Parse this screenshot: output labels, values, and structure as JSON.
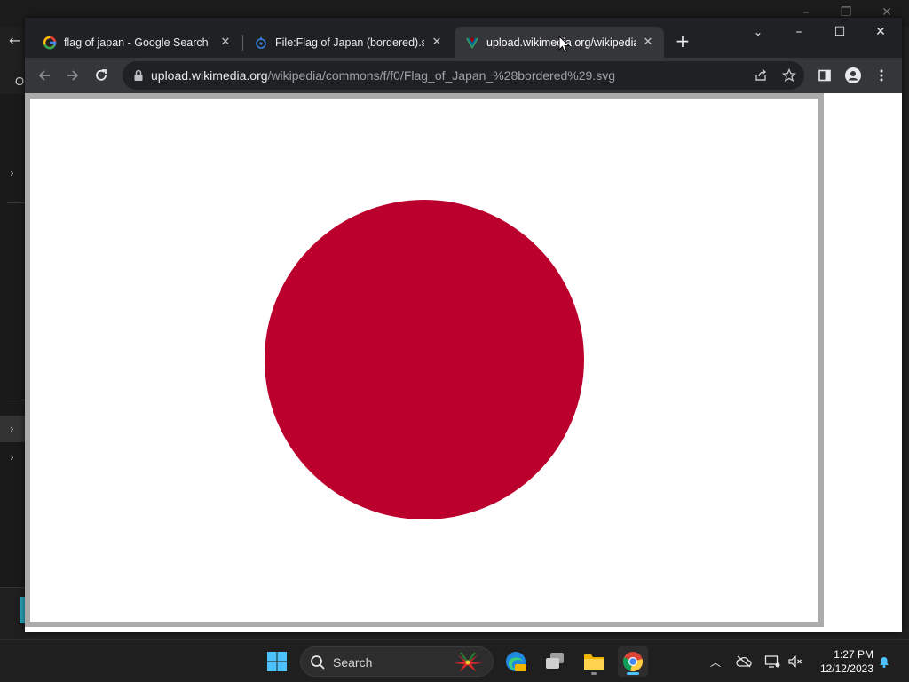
{
  "bg_window": {
    "letter": "O"
  },
  "tabs": [
    {
      "title": "flag of japan - Google Search",
      "favicon": "google-icon"
    },
    {
      "title": "File:Flag of Japan (bordered).svg",
      "favicon": "wikimedia-commons-icon"
    },
    {
      "title": "upload.wikimedia.org/wikipedia/",
      "favicon": "wikimedia-icon",
      "active": true
    }
  ],
  "address_bar": {
    "host": "upload.wikimedia.org",
    "path": "/wikipedia/commons/f/f0/Flag_of_Japan_%28bordered%29.svg"
  },
  "flag": {
    "field_color": "#ffffff",
    "border_color": "#ababab",
    "disc_color": "#bc002d"
  },
  "taskbar": {
    "search_label": "Search",
    "clock_time": "1:27 PM",
    "clock_date": "12/12/2023",
    "accent": "#4cc2ff"
  }
}
